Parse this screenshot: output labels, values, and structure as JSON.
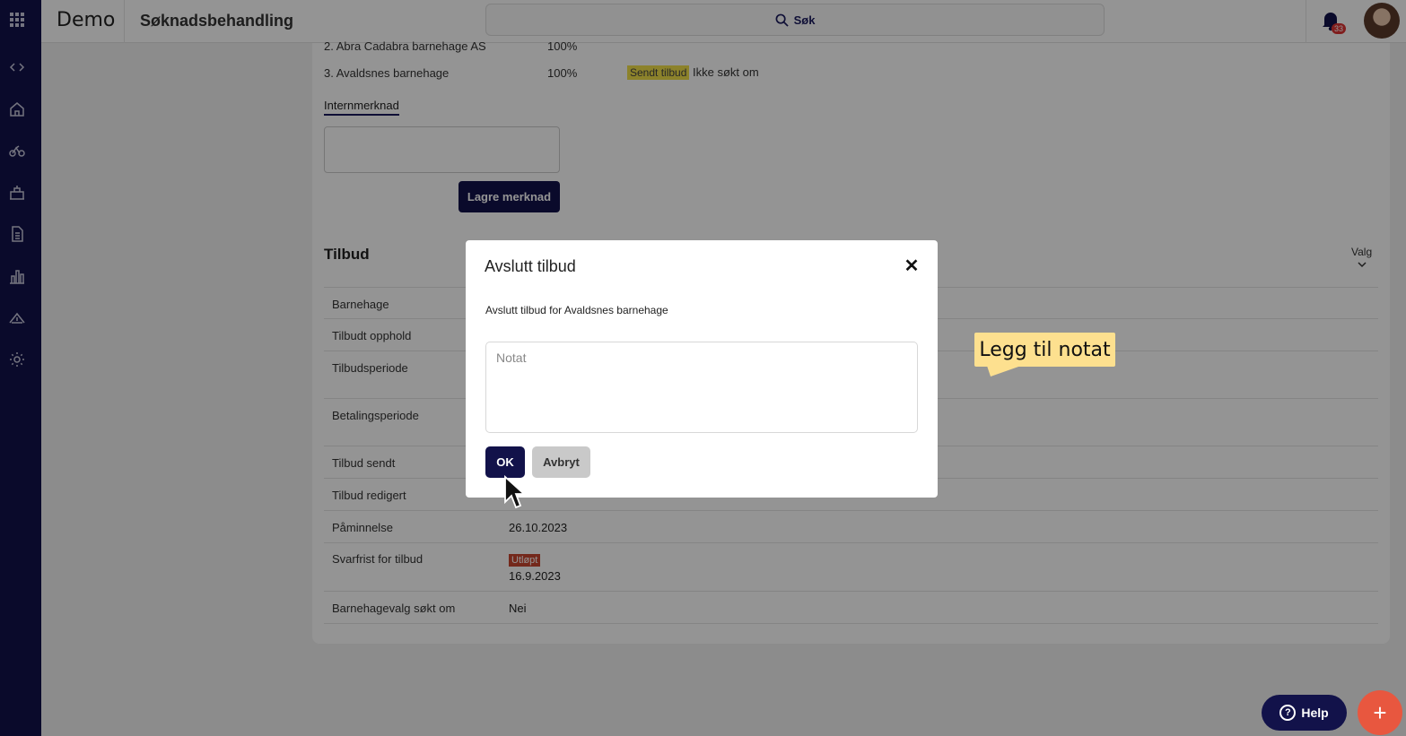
{
  "header": {
    "brand": "Demo",
    "page_title": "Søknadsbehandling",
    "search_label": "Søk",
    "notification_count": "33"
  },
  "sidebar": {
    "items": [
      "apps-grid-icon",
      "code-icon",
      "home-icon",
      "bicycle-icon",
      "building-icon",
      "document-icon",
      "chart-icon",
      "house-money-icon",
      "gear-icon"
    ]
  },
  "preferences": [
    {
      "label": "2. Abra Cadabra barnehage AS",
      "percent": "100%"
    },
    {
      "label": "3. Avaldsnes barnehage",
      "percent": "100%",
      "status_tag": "Sendt tilbud",
      "status_text": "Ikke søkt om"
    }
  ],
  "internal_note": {
    "tab_label": "Internmerknad",
    "save_button": "Lagre merknad"
  },
  "offer": {
    "title": "Tilbud",
    "menu_label": "Valg",
    "rows": [
      {
        "label": "Barnehage",
        "value": ""
      },
      {
        "label": "Tilbudt opphold",
        "value": ""
      },
      {
        "label": "Tilbudsperiode",
        "value": ""
      },
      {
        "label": "Betalingsperiode",
        "value": ""
      },
      {
        "label": "Tilbud sendt",
        "value": ""
      },
      {
        "label": "Tilbud redigert",
        "value": ""
      },
      {
        "label": "Påminnelse",
        "value": "26.10.2023"
      },
      {
        "label": "Svarfrist for tilbud",
        "value": "16.9.2023",
        "tag": "Utløpt"
      },
      {
        "label": "Barnehagevalg søkt om",
        "value": "Nei"
      }
    ]
  },
  "modal": {
    "title": "Avslutt tilbud",
    "text": "Avslutt tilbud for Avaldsnes barnehage",
    "note_placeholder": "Notat",
    "ok_label": "OK",
    "cancel_label": "Avbryt"
  },
  "callout": {
    "text": "Legg til notat"
  },
  "help": {
    "label": "Help"
  },
  "colors": {
    "primary": "#12124a",
    "accent": "#e8573f",
    "callout": "#fde08f",
    "tag_yellow": "#f1e04b",
    "tag_red": "#c8452f"
  }
}
